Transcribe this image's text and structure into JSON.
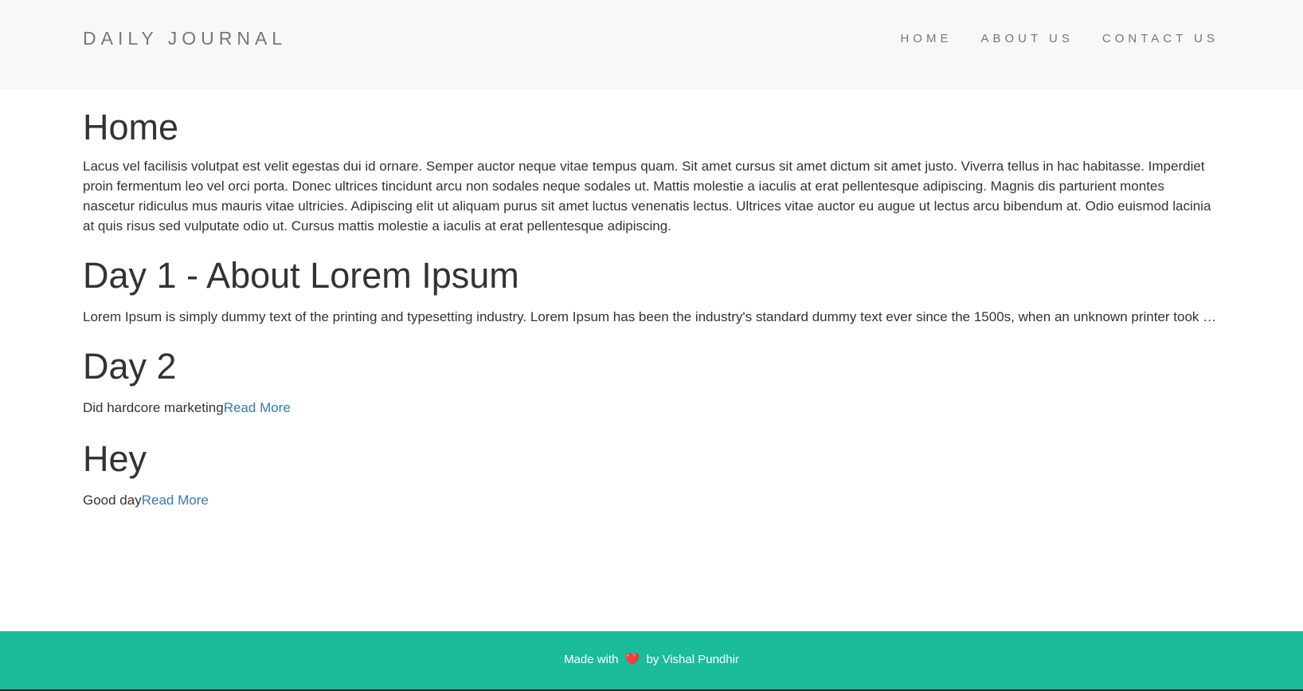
{
  "navbar": {
    "brand": "DAILY JOURNAL",
    "links": [
      "HOME",
      "ABOUT US",
      "CONTACT US"
    ]
  },
  "main": {
    "home": {
      "title": "Home",
      "body": "Lacus vel facilisis volutpat est velit egestas dui id ornare. Semper auctor neque vitae tempus quam. Sit amet cursus sit amet dictum sit amet justo. Viverra tellus in hac habitasse. Imperdiet proin fermentum leo vel orci porta. Donec ultrices tincidunt arcu non sodales neque sodales ut. Mattis molestie a iaculis at erat pellentesque adipiscing. Magnis dis parturient montes nascetur ridiculus mus mauris vitae ultricies. Adipiscing elit ut aliquam purus sit amet luctus venenatis lectus. Ultrices vitae auctor eu augue ut lectus arcu bibendum at. Odio euismod lacinia at quis risus sed vulputate odio ut. Cursus mattis molestie a iaculis at erat pellentesque adipiscing."
    },
    "posts": [
      {
        "title": "Day 1 - About Lorem Ipsum",
        "body": "Lorem Ipsum is simply dummy text of the printing and typesetting industry. Lorem Ipsum has been the industry's standard dummy text ever since the 1500s, when an unknown printer took a galley of type and scrambled it to make a type specimen book.",
        "read_more": ""
      },
      {
        "title": "Day 2",
        "body": "Did hardcore marketing",
        "read_more": "Read More"
      },
      {
        "title": "Hey",
        "body": "Good day",
        "read_more": "Read More"
      }
    ]
  },
  "footer": {
    "prefix": "Made with",
    "icon": "heart-icon",
    "suffix": "by Vishal Pundhir"
  },
  "colors": {
    "navbar_bg": "#f8f8f8",
    "footer_bg": "#1abc9c",
    "link": "#337ab7"
  }
}
